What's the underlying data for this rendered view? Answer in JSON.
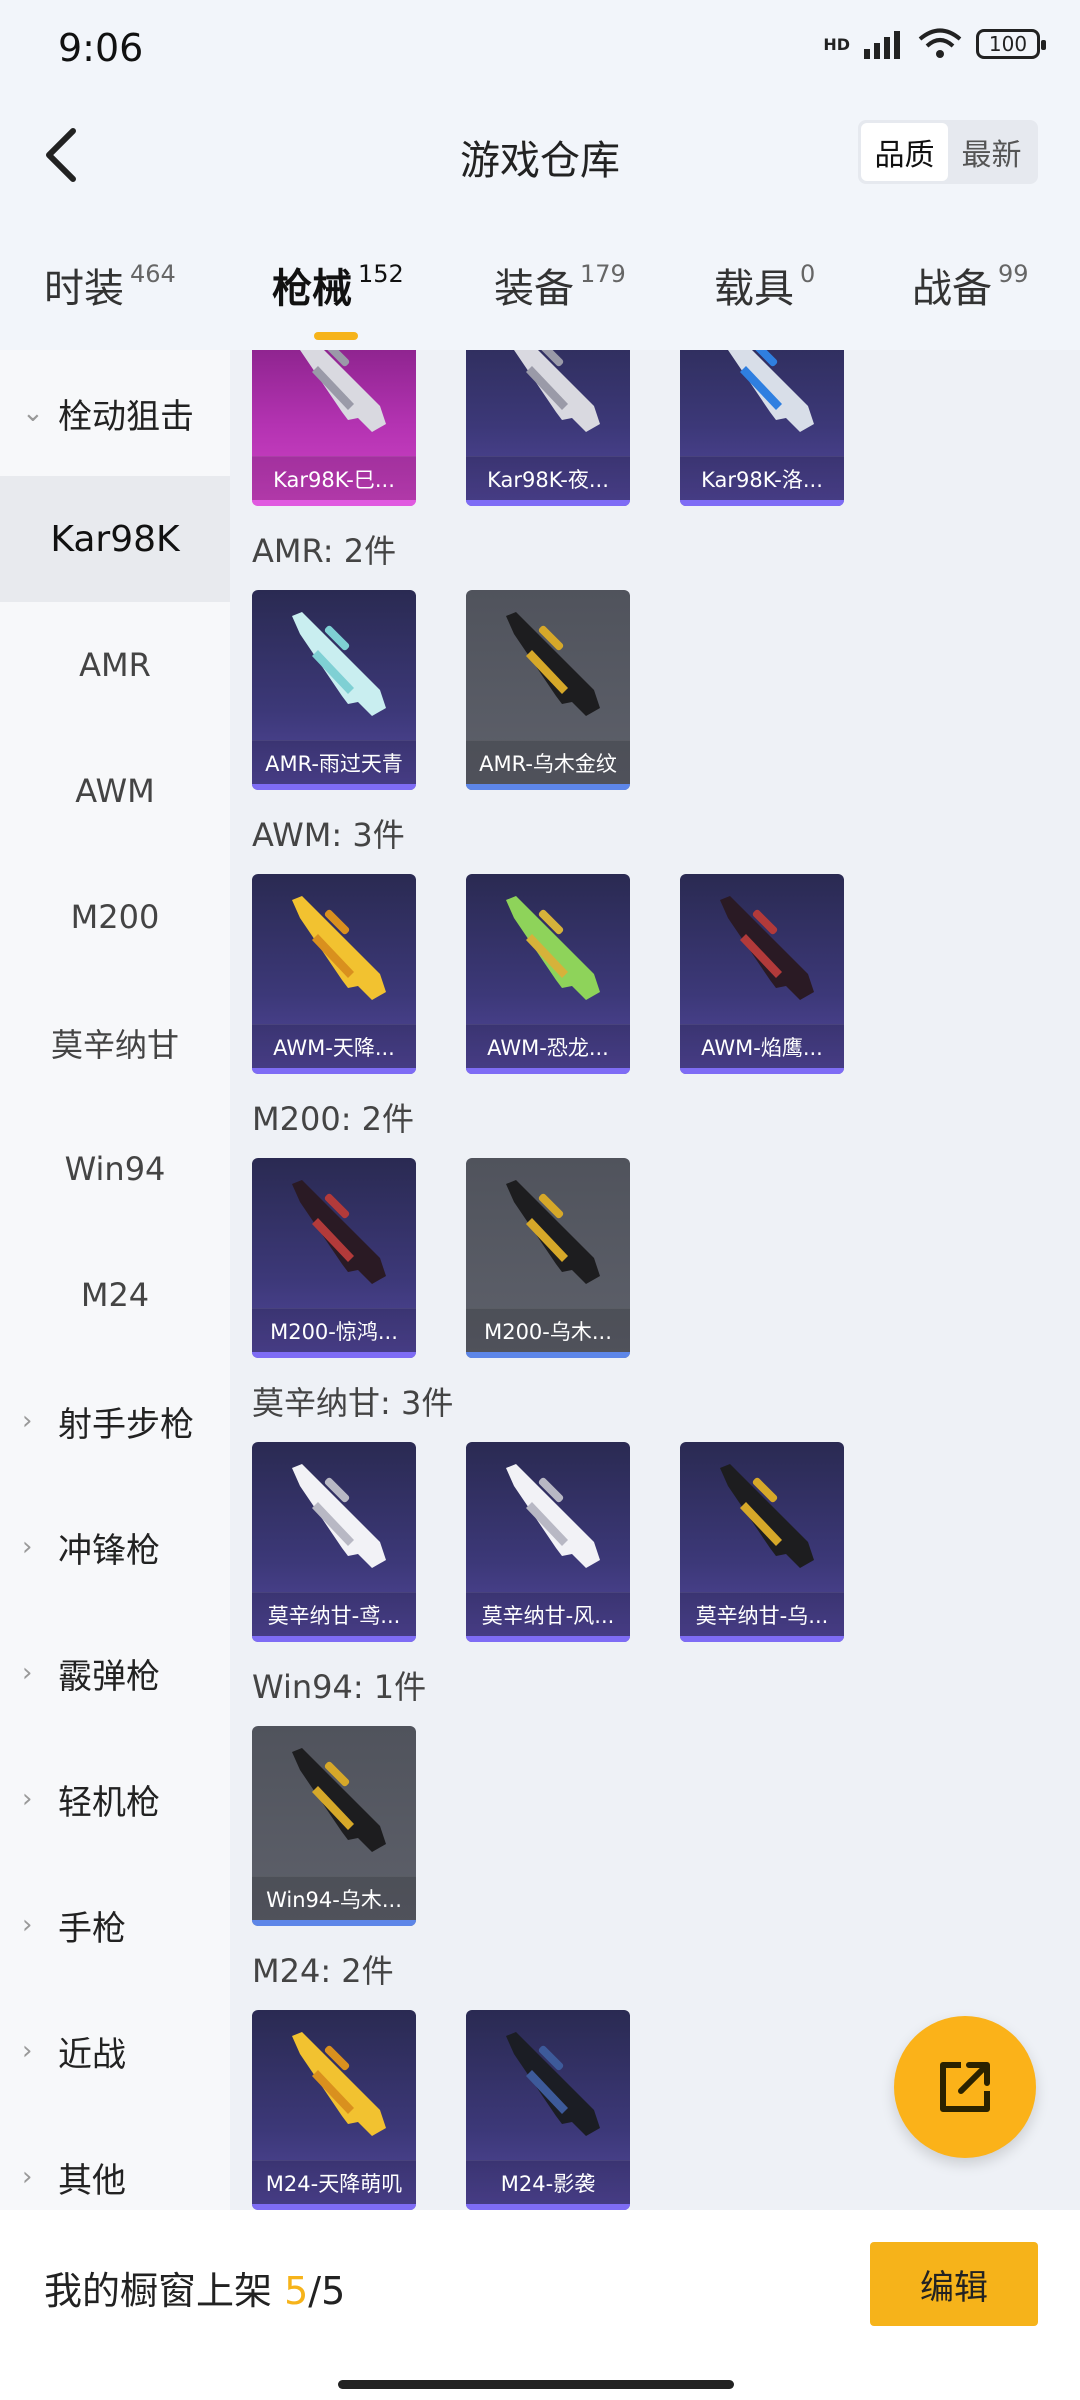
{
  "status_bar": {
    "time": "9:06",
    "battery": "100",
    "network": "HD"
  },
  "header": {
    "title": "游戏仓库",
    "sort_options": [
      "品质",
      "最新"
    ],
    "active_sort": "品质"
  },
  "tabs": [
    {
      "label": "时装",
      "count": "464"
    },
    {
      "label": "枪械",
      "count": "152",
      "active": true
    },
    {
      "label": "装备",
      "count": "179"
    },
    {
      "label": "载具",
      "count": "0"
    },
    {
      "label": "战备",
      "count": "99"
    }
  ],
  "sidebar": {
    "items": [
      {
        "label": "栓动狙击",
        "type": "category",
        "expanded": true
      },
      {
        "label": "Kar98K",
        "type": "sub",
        "selected": true
      },
      {
        "label": "AMR",
        "type": "sub"
      },
      {
        "label": "AWM",
        "type": "sub"
      },
      {
        "label": "M200",
        "type": "sub"
      },
      {
        "label": "莫辛纳甘",
        "type": "sub"
      },
      {
        "label": "Win94",
        "type": "sub"
      },
      {
        "label": "M24",
        "type": "sub"
      },
      {
        "label": "射手步枪",
        "type": "category"
      },
      {
        "label": "冲锋枪",
        "type": "category"
      },
      {
        "label": "霰弹枪",
        "type": "category"
      },
      {
        "label": "轻机枪",
        "type": "category"
      },
      {
        "label": "手枪",
        "type": "category"
      },
      {
        "label": "近战",
        "type": "category"
      },
      {
        "label": "其他",
        "type": "category"
      }
    ]
  },
  "sections": [
    {
      "title": "",
      "items": [
        {
          "name": "Kar98K-巳...",
          "rarity": "pink",
          "gun": "silver"
        },
        {
          "name": "Kar98K-夜...",
          "rarity": "purple",
          "gun": "silver"
        },
        {
          "name": "Kar98K-洛...",
          "rarity": "purple",
          "gun": "blue"
        }
      ]
    },
    {
      "title": "AMR: 2件",
      "items": [
        {
          "name": "AMR-雨过天青",
          "rarity": "purple",
          "gun": "teal"
        },
        {
          "name": "AMR-乌木金纹",
          "rarity": "gray",
          "gun": "gold"
        }
      ]
    },
    {
      "title": "AWM: 3件",
      "items": [
        {
          "name": "AWM-天降...",
          "rarity": "purple",
          "gun": "yellow"
        },
        {
          "name": "AWM-恐龙...",
          "rarity": "purple",
          "gun": "green"
        },
        {
          "name": "AWM-焰鹰...",
          "rarity": "purple",
          "gun": "red"
        }
      ]
    },
    {
      "title": "M200: 2件",
      "items": [
        {
          "name": "M200-惊鸿...",
          "rarity": "purple",
          "gun": "red"
        },
        {
          "name": "M200-乌木...",
          "rarity": "gray",
          "gun": "gold"
        }
      ]
    },
    {
      "title": "莫辛纳甘: 3件",
      "items": [
        {
          "name": "莫辛纳甘-鸢...",
          "rarity": "purple",
          "gun": "white"
        },
        {
          "name": "莫辛纳甘-风...",
          "rarity": "purple",
          "gun": "white"
        },
        {
          "name": "莫辛纳甘-乌...",
          "rarity": "purple",
          "gun": "gold"
        }
      ]
    },
    {
      "title": "Win94: 1件",
      "items": [
        {
          "name": "Win94-乌木...",
          "rarity": "gray",
          "gun": "gold"
        }
      ]
    },
    {
      "title": "M24: 2件",
      "items": [
        {
          "name": "M24-天降萌叽",
          "rarity": "purple",
          "gun": "yellow"
        },
        {
          "name": "M24-影袭",
          "rarity": "purple",
          "gun": "dark"
        }
      ]
    }
  ],
  "bottom_bar": {
    "showcase_label": "我的橱窗上架",
    "showcase_current": "5",
    "showcase_total": "/5",
    "edit_label": "编辑"
  },
  "colors": {
    "accent": "#f6b31a",
    "rarity_purple": "#7e6cf5",
    "rarity_gray": "#5d86e8",
    "rarity_pink": "#e05ae0"
  }
}
